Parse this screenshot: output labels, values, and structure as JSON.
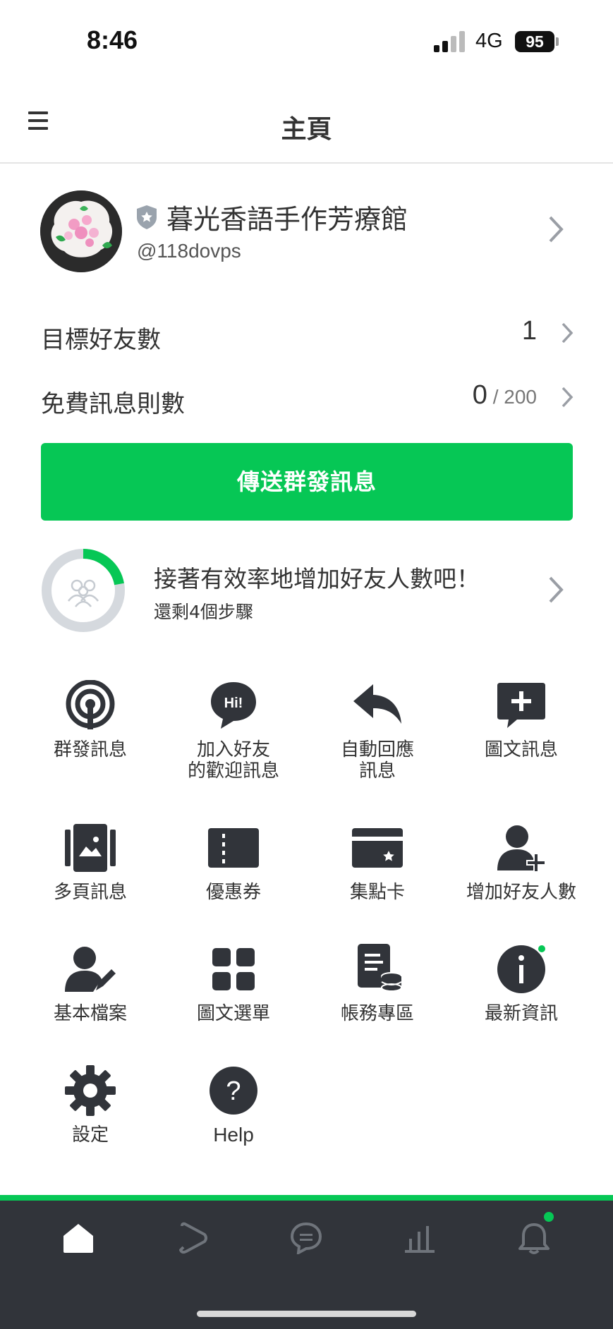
{
  "status_bar": {
    "time": "8:46",
    "network": "4G",
    "battery": "95"
  },
  "header": {
    "title": "主頁"
  },
  "account": {
    "name": "暮光香語手作芳療館",
    "id": "@118dovps"
  },
  "stats": [
    {
      "label": "目標好友數",
      "value": "1",
      "total": ""
    },
    {
      "label": "免費訊息則數",
      "value": "0",
      "total": " / 200"
    }
  ],
  "broadcast_button": {
    "label": "傳送群發訊息"
  },
  "tip": {
    "title": "接著有效率地增加好友人數吧！",
    "subtitle": "還剩4個步驟"
  },
  "features": [
    {
      "label": "群發訊息",
      "icon": "broadcast-icon"
    },
    {
      "label": "加入好友\n的歡迎訊息",
      "icon": "greeting-bubble-icon"
    },
    {
      "label": "自動回應\n訊息",
      "icon": "reply-arrow-icon"
    },
    {
      "label": "圖文訊息",
      "icon": "rich-message-icon"
    },
    {
      "label": "多頁訊息",
      "icon": "card-message-icon"
    },
    {
      "label": "優惠券",
      "icon": "coupon-icon"
    },
    {
      "label": "集點卡",
      "icon": "reward-card-icon"
    },
    {
      "label": "增加好友人數",
      "icon": "add-friend-icon"
    },
    {
      "label": "基本檔案",
      "icon": "profile-edit-icon"
    },
    {
      "label": "圖文選單",
      "icon": "rich-menu-icon"
    },
    {
      "label": "帳務專區",
      "icon": "billing-icon"
    },
    {
      "label": "最新資訊",
      "icon": "info-icon"
    },
    {
      "label": "設定",
      "icon": "gear-icon"
    },
    {
      "label": "Help",
      "icon": "help-icon"
    }
  ],
  "bottom_nav": [
    "home-icon",
    "play-icon",
    "chat-icon",
    "chart-icon",
    "bell-icon"
  ],
  "colors": {
    "accent": "#06c755",
    "nav_bg": "#31343a",
    "icon": "#31343a"
  }
}
